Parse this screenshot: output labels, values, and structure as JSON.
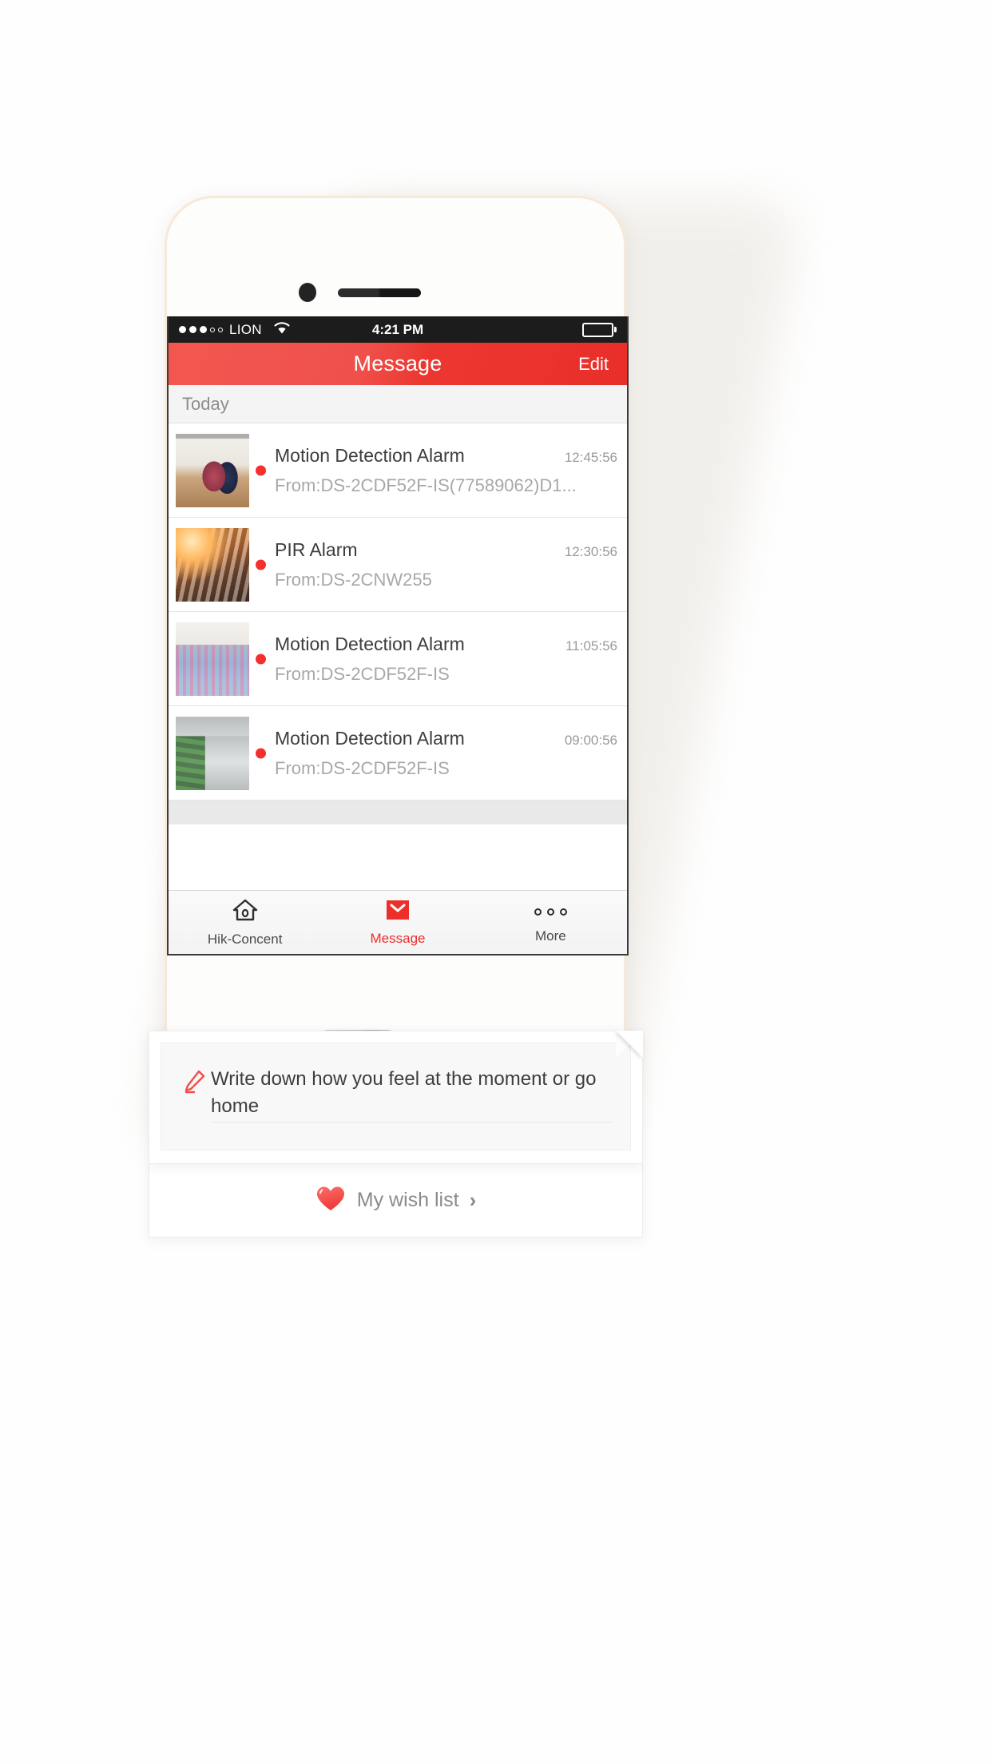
{
  "status_bar": {
    "carrier": "LION",
    "time": "4:21 PM",
    "signal_filled": 3,
    "signal_total": 5,
    "wifi_icon": "wifi-icon",
    "battery_icon": "battery-full-icon"
  },
  "nav_bar": {
    "title": "Message",
    "edit_label": "Edit",
    "accent_color": "#ec3730"
  },
  "section": {
    "today_label": "Today"
  },
  "messages": [
    {
      "title": "Motion Detection Alarm",
      "time": "12:45:56",
      "source": "From:DS-2CDF52F-IS(77589062)D1...",
      "unread": true,
      "thumb_class": "thumb-1"
    },
    {
      "title": "PIR Alarm",
      "time": "12:30:56",
      "source": "From:DS-2CNW255",
      "unread": true,
      "thumb_class": "thumb-2"
    },
    {
      "title": "Motion Detection Alarm",
      "time": "11:05:56",
      "source": "From:DS-2CDF52F-IS",
      "unread": true,
      "thumb_class": "thumb-3"
    },
    {
      "title": "Motion Detection Alarm",
      "time": "09:00:56",
      "source": "From:DS-2CDF52F-IS",
      "unread": true,
      "thumb_class": "thumb-4"
    }
  ],
  "note_overlay": {
    "pencil_icon": "pencil-icon",
    "text": "Write down how you feel at the moment or go home",
    "wishlist_label": "My wish list",
    "wishlist_heart_icon": "heart-icon",
    "wishlist_chevron_icon": "chevron-right-icon",
    "heart_color": "#f4504e"
  },
  "tab_bar": {
    "items": [
      {
        "label": "Hik-Concent",
        "icon": "home-icon",
        "active": false
      },
      {
        "label": "Message",
        "icon": "envelope-icon",
        "active": true
      },
      {
        "label": "More",
        "icon": "more-dots-icon",
        "active": false
      }
    ]
  }
}
